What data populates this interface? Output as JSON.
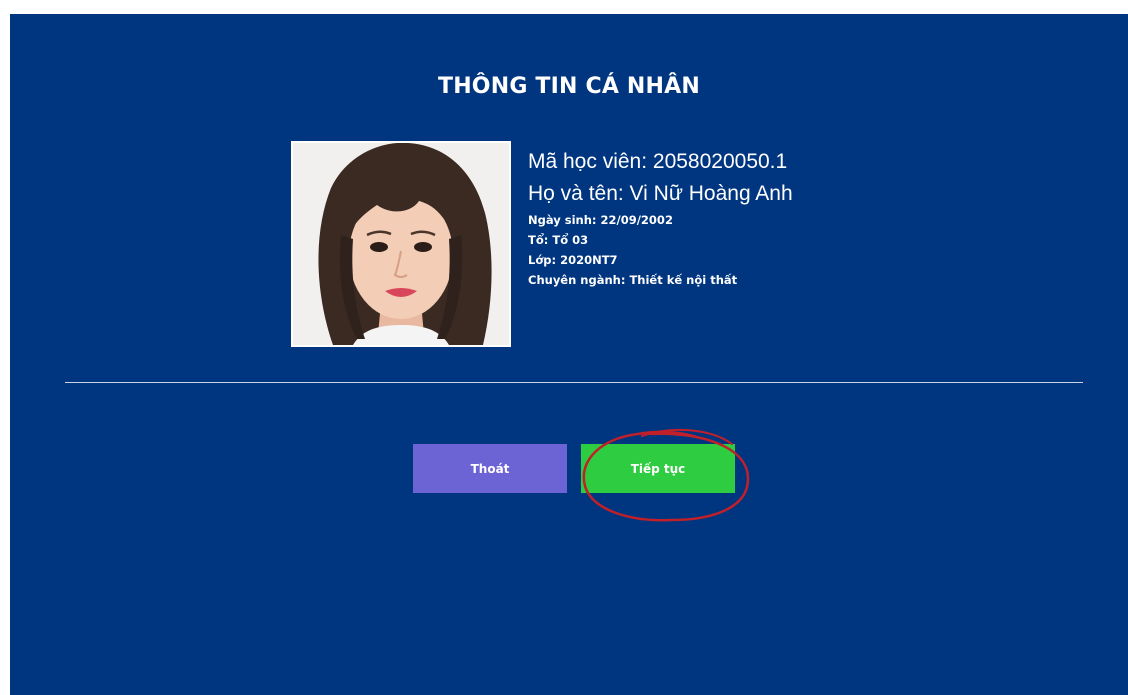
{
  "page": {
    "title": "THÔNG TIN CÁ NHÂN"
  },
  "student": {
    "id_line": "Mã học viên: 2058020050.1",
    "name_line": "Họ và tên: Vi Nữ Hoàng Anh",
    "birth_line": "Ngày sinh: 22/09/2002",
    "group_line": "Tổ: Tổ 03",
    "class_line": "Lớp: 2020NT7",
    "major_line": "Chuyên ngành: Thiết kế nội thất"
  },
  "actions": {
    "exit_label": "Thoát",
    "continue_label": "Tiếp tục"
  },
  "colors": {
    "background": "#003580",
    "exit_button": "#6c63d4",
    "continue_button": "#2ecc40",
    "annotation": "#c0202a"
  }
}
